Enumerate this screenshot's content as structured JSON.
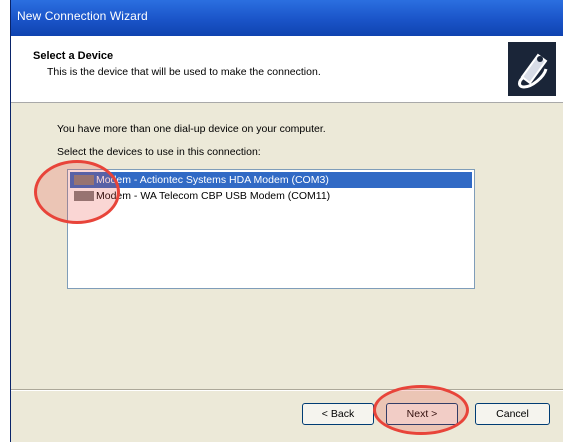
{
  "window": {
    "title": "New Connection Wizard"
  },
  "header": {
    "title": "Select a Device",
    "subtitle": "This is the device that will be used to make the connection.",
    "icon": "modem-phone-icon"
  },
  "body": {
    "intro": "You have more than one dial-up device on your computer.",
    "prompt": "Select the devices to use in this connection:"
  },
  "devices": [
    {
      "label": "Modem - Actiontec Systems HDA Modem (COM3)",
      "checked": true,
      "selected": true
    },
    {
      "label": "Modem - WA Telecom CBP USB Modem (COM11)",
      "checked": true,
      "selected": false
    }
  ],
  "buttons": {
    "back": "< Back",
    "next": "Next >",
    "cancel": "Cancel"
  },
  "annotations": {
    "color": "#e8443a"
  },
  "colors": {
    "title_bar": "#1a54c8",
    "selection": "#316ac5",
    "dialog_bg": "#ece9d8"
  }
}
